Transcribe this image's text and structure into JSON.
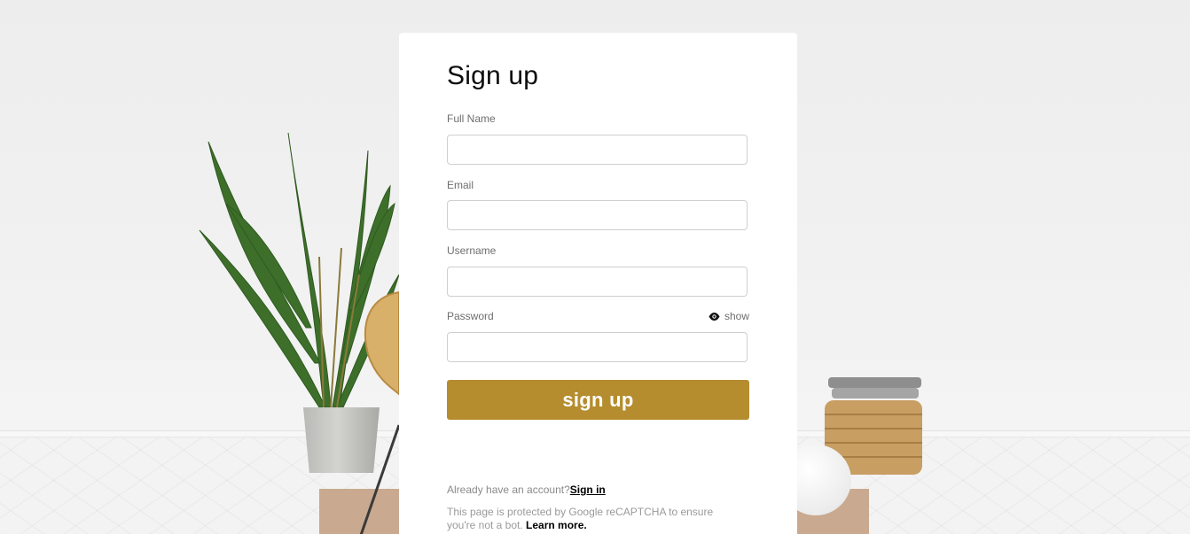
{
  "form": {
    "title": "Sign up",
    "fields": {
      "full_name": {
        "label": "Full Name",
        "value": "",
        "placeholder": ""
      },
      "email": {
        "label": "Email",
        "value": "",
        "placeholder": ""
      },
      "username": {
        "label": "Username",
        "value": "",
        "placeholder": ""
      },
      "password": {
        "label": "Password",
        "value": "",
        "placeholder": "",
        "toggle_label": "show",
        "toggle_icon": "eye-icon"
      }
    },
    "submit_label": "sign up",
    "accent_color": "#b58d2e"
  },
  "footer": {
    "signin_prompt": "Already have an account?",
    "signin_link": "Sign in",
    "recaptcha_text": "This page is protected by Google reCAPTCHA to ensure you're not a bot.",
    "learn_more_link": "Learn more."
  }
}
